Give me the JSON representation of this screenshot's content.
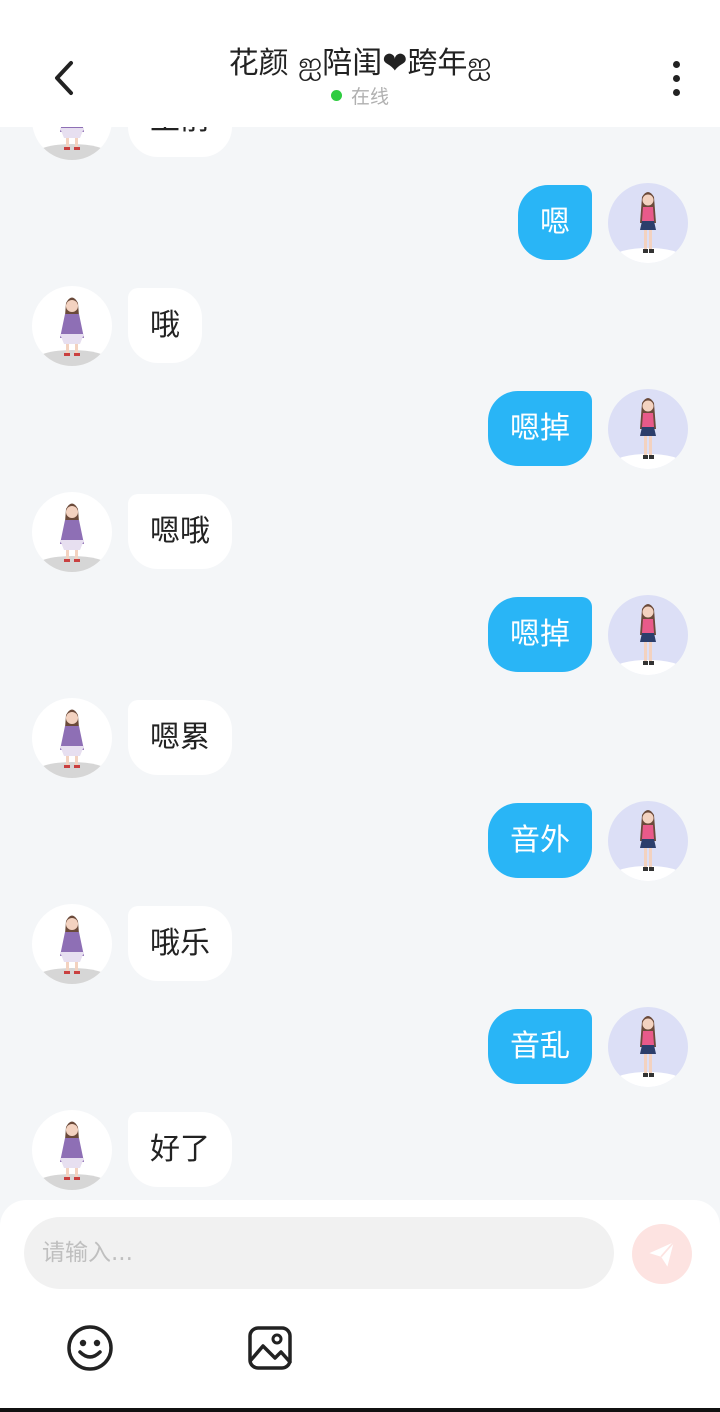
{
  "header": {
    "title": "花颜 ஐ陪闺❤跨年ஐ",
    "status": "在线"
  },
  "messages": [
    {
      "side": "left",
      "text": "王前",
      "partial": true
    },
    {
      "side": "right",
      "text": "嗯"
    },
    {
      "side": "left",
      "text": "哦"
    },
    {
      "side": "right",
      "text": "嗯掉"
    },
    {
      "side": "left",
      "text": "嗯哦"
    },
    {
      "side": "right",
      "text": "嗯掉"
    },
    {
      "side": "left",
      "text": "嗯累"
    },
    {
      "side": "right",
      "text": "音外"
    },
    {
      "side": "left",
      "text": "哦乐"
    },
    {
      "side": "right",
      "text": "音乱"
    },
    {
      "side": "left",
      "text": "好了"
    }
  ],
  "composer": {
    "placeholder": "请输入...",
    "send_icon": "send-paper-plane-icon",
    "emoji_icon": "emoji-face-icon",
    "image_icon": "image-picture-icon"
  },
  "colors": {
    "outgoing_bubble": "#29b5f6",
    "incoming_bubble": "#ffffff",
    "online_dot": "#2ecc40",
    "send_button": "#fde3e1"
  }
}
